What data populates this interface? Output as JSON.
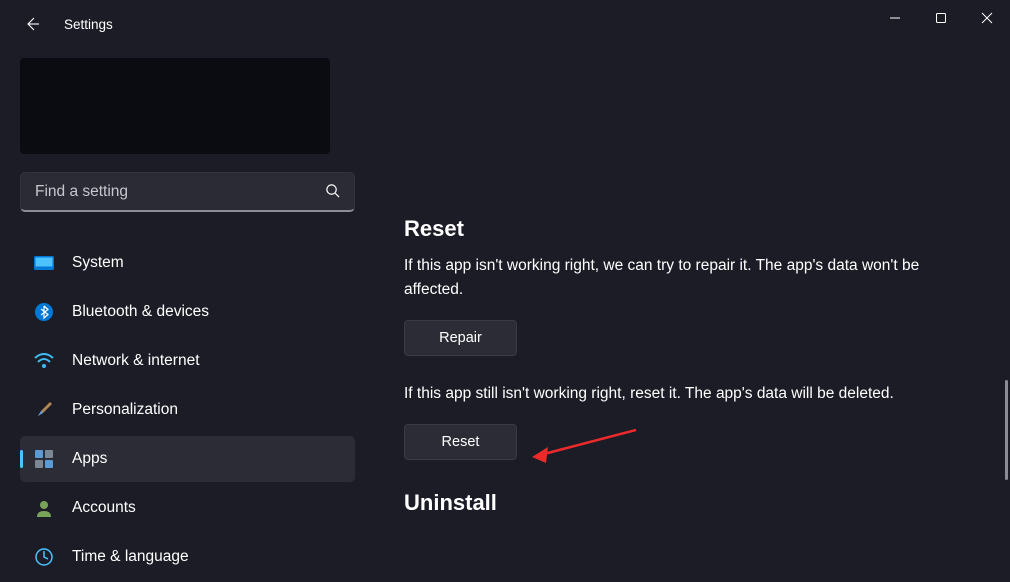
{
  "titlebar": {
    "title": "Settings"
  },
  "search": {
    "placeholder": "Find a setting"
  },
  "nav": {
    "system": "System",
    "bluetooth": "Bluetooth & devices",
    "network": "Network & internet",
    "personalization": "Personalization",
    "apps": "Apps",
    "accounts": "Accounts",
    "time": "Time & language"
  },
  "content": {
    "reset_heading": "Reset",
    "repair_text": "If this app isn't working right, we can try to repair it. The app's data won't be affected.",
    "repair_button": "Repair",
    "reset_text": "If this app still isn't working right, reset it. The app's data will be deleted.",
    "reset_button": "Reset",
    "uninstall_heading": "Uninstall"
  }
}
